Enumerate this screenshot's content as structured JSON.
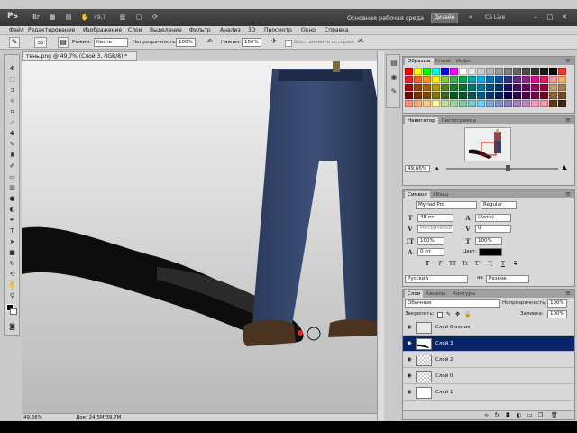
{
  "appbar": {
    "logo": "Ps",
    "zoom": "49,7",
    "workspace_label": "Основная рабочая среда",
    "workspace_button": "Дизайн",
    "cslive": "CS Live"
  },
  "menubar": {
    "items": [
      "Файл",
      "Редактирование",
      "Изображение",
      "Слои",
      "Выделение",
      "Фильтр",
      "Анализ",
      "3D",
      "Просмотр",
      "Окно",
      "Справка"
    ]
  },
  "options": {
    "brush_size": "55",
    "mode_label": "Режим:",
    "mode_value": "Кисть",
    "opacity_label": "Непрозрачность:",
    "opacity_value": "100%",
    "flow_label": "Нажим:",
    "flow_value": "100%",
    "restore_label": "Восстановить историю"
  },
  "document": {
    "tab_title": "тень.png @ 49,7% (Слой 3, RGB/8) *",
    "zoom": "49,66%",
    "doc_info": "Док: 24,5M/39,7M"
  },
  "panels": {
    "swatches": {
      "tabs": [
        "Образцы",
        "Стили",
        "Инфо"
      ],
      "colors": [
        "#ff0000",
        "#ffff00",
        "#00ff00",
        "#00ffff",
        "#0000ff",
        "#ff00ff",
        "#ffffff",
        "#e6e6e6",
        "#cccccc",
        "#b3b3b3",
        "#999999",
        "#808080",
        "#666666",
        "#4d4d4d",
        "#333333",
        "#1a1a1a",
        "#000000",
        "#ff3333",
        "#ed1c24",
        "#f26522",
        "#f7941d",
        "#fff200",
        "#8dc63f",
        "#39b54a",
        "#00a651",
        "#00a99d",
        "#00aeef",
        "#0072bc",
        "#0054a6",
        "#2e3192",
        "#662d91",
        "#92278f",
        "#ec008c",
        "#ed145b",
        "#f5989d",
        "#fbaf5d",
        "#9e0b0f",
        "#a0410d",
        "#a36209",
        "#aba000",
        "#598527",
        "#1a7b30",
        "#007236",
        "#00746b",
        "#0076a3",
        "#004b80",
        "#003471",
        "#1b1464",
        "#440e62",
        "#630460",
        "#9e005d",
        "#9e0039",
        "#c69c6d",
        "#a67c52",
        "#790000",
        "#7b2e00",
        "#7d4900",
        "#827b00",
        "#406618",
        "#005e20",
        "#005826",
        "#005952",
        "#005b7f",
        "#003663",
        "#002157",
        "#0d004c",
        "#32004b",
        "#4b0049",
        "#7b0046",
        "#7a0026",
        "#8c6239",
        "#754c24",
        "#f69679",
        "#f9ad81",
        "#fdc68a",
        "#fff799",
        "#c4df9b",
        "#a3d39c",
        "#82ca9d",
        "#7accc8",
        "#6dcff6",
        "#7da7d9",
        "#8393ca",
        "#8781bd",
        "#a186be",
        "#bd8cbf",
        "#f49ac1",
        "#f6989d",
        "#603913",
        "#3c2415"
      ]
    },
    "navigator": {
      "tabs": [
        "Навигатор",
        "Гистограмма"
      ],
      "zoom": "49,66%",
      "zoom_level": 0.55
    },
    "character": {
      "tabs": [
        "Символ",
        "Абзац"
      ],
      "font_family": "Myriad Pro",
      "font_style": "Regular",
      "font_size": "48 пт",
      "leading": "(Авто)",
      "kerning": "Метрически",
      "tracking": "0",
      "vscale": "100%",
      "hscale": "100%",
      "baseline": "0 пт",
      "color_label": "Цвет:",
      "styles": [
        "T",
        "T",
        "TT",
        "Tr",
        "T¹",
        "T,",
        "T",
        "T"
      ],
      "language": "Русский",
      "aa_label": "aa",
      "antialias": "Резкое"
    },
    "layers": {
      "tabs": [
        "Слои",
        "Каналы",
        "Контуры"
      ],
      "blend_mode": "Обычные",
      "opacity_label": "Непрозрачность:",
      "opacity_value": "100%",
      "lock_label": "Закрепить:",
      "fill_label": "Заливка:",
      "fill_value": "100%",
      "items": [
        {
          "name": "Слой 0 копия",
          "selected": false
        },
        {
          "name": "Слой 3",
          "selected": true
        },
        {
          "name": "Слой 2",
          "selected": false
        },
        {
          "name": "Слой 0",
          "selected": false
        },
        {
          "name": "Слой 1",
          "selected": false
        }
      ]
    }
  }
}
